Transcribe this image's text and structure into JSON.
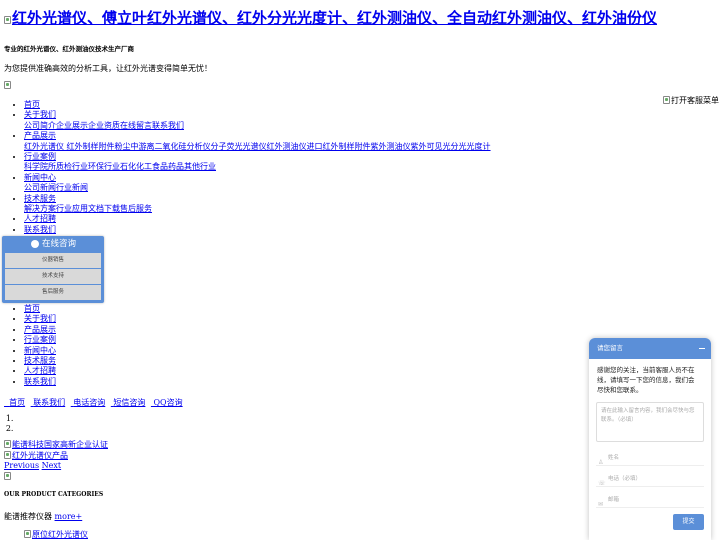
{
  "header": {
    "title": "红外光谱仪、傅立叶红外光谱仪、红外分光光度计、红外测油仪、全自动红外测油仪、红外油份仪",
    "tagline_strong": "专业的红外光谱仪、红外测油仪技术生产厂商",
    "tagline": "为您提供准确高效的分析工具，让红外光谱变得简单无忧！",
    "open_menu_alt": "打开客服菜单"
  },
  "nav": [
    {
      "label": "首页"
    },
    {
      "label": "关于我们",
      "sub": "公司简介企业展示企业资质在线留言联系我们"
    },
    {
      "label": "产品展示",
      "sub": "红外光谱仪 红外制样附件粉尘中游离二氧化硅分析仪分子荧光光谱仪红外测油仪进口红外制样附件紫外测油仪紫外可见光分光光度计"
    },
    {
      "label": "行业案例",
      "sub": "科学院所质检行业环保行业石化化工食品药品其他行业"
    },
    {
      "label": "新闻中心",
      "sub": "公司新闻行业新闻"
    },
    {
      "label": "技术服务",
      "sub": "解决方案行业应用文档下载售后服务"
    },
    {
      "label": "人才招聘"
    },
    {
      "label": "联系我们"
    }
  ],
  "nav_secondary": [
    "首页",
    "关于我们",
    "产品展示",
    "行业案例",
    "新闻中心",
    "技术服务",
    "人才招聘",
    "联系我们"
  ],
  "consult": {
    "title": "在线咨询",
    "buttons": [
      "仪器销售",
      "技术支持",
      "售后服务"
    ]
  },
  "quick_links": [
    "首页",
    "联系我们",
    "电话咨询",
    "短信咨询",
    "QQ咨询"
  ],
  "slides": [
    "",
    ""
  ],
  "banners": {
    "img1_alt": "能谱科技国家高新企业认证",
    "img2_alt": "红外光谱仪产品",
    "prev": "Previous",
    "next": "Next"
  },
  "categories": {
    "title": "OUR PRODUCT CATEGORIES",
    "recommend_label": "能谱推荐仪器",
    "more": "more+",
    "first_item_alt": "原位红外光谱仪"
  },
  "chat": {
    "title": "请您留言",
    "message": "感谢您的关注，当前客服人员不在\n线，请填写一下您的信息，我们会\n尽快和您联系。",
    "textarea_placeholder": "请在此输入留言内容，我们会尽快与您联系。（必填）",
    "name_placeholder": "姓名",
    "phone_placeholder": "电话（必填）",
    "email_placeholder": "邮箱",
    "submit": "提交"
  }
}
